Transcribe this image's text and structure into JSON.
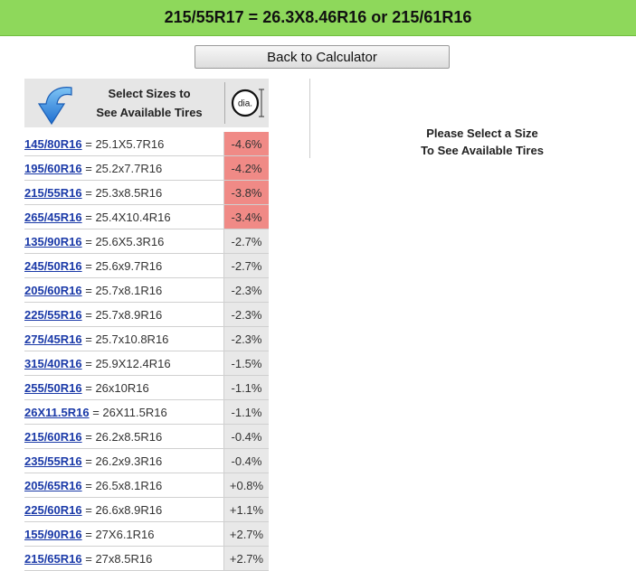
{
  "title": "215/55R17 = 26.3X8.46R16 or 215/61R16",
  "back_button": "Back to Calculator",
  "header": {
    "line1": "Select Sizes to",
    "line2": "See Available Tires",
    "dia_label": "dia."
  },
  "right_message": {
    "line1": "Please Select a Size",
    "line2": "To See Available Tires"
  },
  "colors": {
    "green_bar": "#8ed85b",
    "red_cell": "#f08a86",
    "gray_cell": "#e8e8e8",
    "link": "#1b3aa8"
  },
  "rows": [
    {
      "size": "145/80R16",
      "dims": "= 25.1X5.7R16",
      "pct": "-4.6%",
      "highlight": true
    },
    {
      "size": "195/60R16",
      "dims": "= 25.2x7.7R16",
      "pct": "-4.2%",
      "highlight": true
    },
    {
      "size": "215/55R16",
      "dims": "= 25.3x8.5R16",
      "pct": "-3.8%",
      "highlight": true
    },
    {
      "size": "265/45R16",
      "dims": "= 25.4X10.4R16",
      "pct": "-3.4%",
      "highlight": true
    },
    {
      "size": "135/90R16",
      "dims": "= 25.6X5.3R16",
      "pct": "-2.7%",
      "highlight": false
    },
    {
      "size": "245/50R16",
      "dims": "= 25.6x9.7R16",
      "pct": "-2.7%",
      "highlight": false
    },
    {
      "size": "205/60R16",
      "dims": "= 25.7x8.1R16",
      "pct": "-2.3%",
      "highlight": false
    },
    {
      "size": "225/55R16",
      "dims": "= 25.7x8.9R16",
      "pct": "-2.3%",
      "highlight": false
    },
    {
      "size": "275/45R16",
      "dims": "= 25.7x10.8R16",
      "pct": "-2.3%",
      "highlight": false
    },
    {
      "size": "315/40R16",
      "dims": "= 25.9X12.4R16",
      "pct": "-1.5%",
      "highlight": false
    },
    {
      "size": "255/50R16",
      "dims": "= 26x10R16",
      "pct": "-1.1%",
      "highlight": false
    },
    {
      "size": "26X11.5R16",
      "dims": "= 26X11.5R16",
      "pct": "-1.1%",
      "highlight": false
    },
    {
      "size": "215/60R16",
      "dims": "= 26.2x8.5R16",
      "pct": "-0.4%",
      "highlight": false
    },
    {
      "size": "235/55R16",
      "dims": "= 26.2x9.3R16",
      "pct": "-0.4%",
      "highlight": false
    },
    {
      "size": "205/65R16",
      "dims": "= 26.5x8.1R16",
      "pct": "+0.8%",
      "highlight": false
    },
    {
      "size": "225/60R16",
      "dims": "= 26.6x8.9R16",
      "pct": "+1.1%",
      "highlight": false
    },
    {
      "size": "155/90R16",
      "dims": "= 27X6.1R16",
      "pct": "+2.7%",
      "highlight": false
    },
    {
      "size": "215/65R16",
      "dims": "= 27x8.5R16",
      "pct": "+2.7%",
      "highlight": false
    }
  ]
}
